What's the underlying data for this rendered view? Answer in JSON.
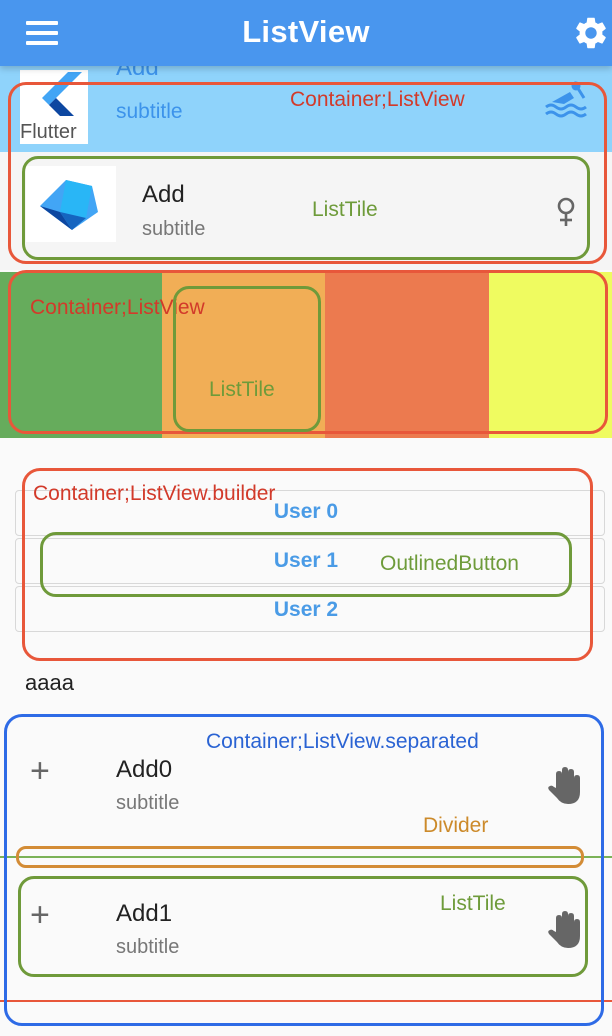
{
  "app_bar": {
    "title": "ListView",
    "background": "#4996EE"
  },
  "section1": {
    "cut_title": "Add",
    "top_subtitle": "subtitle",
    "flutter_logo_text": "Flutter",
    "tile": {
      "title": "Add",
      "subtitle": "subtitle"
    },
    "annotations": {
      "container": "Container;ListView",
      "tile": "ListTile"
    }
  },
  "section2": {
    "stripe_colors": [
      "#66AC5C",
      "#F1AE56",
      "#EC7A4F",
      "#EFFB60"
    ],
    "annotations": {
      "container": "Container;ListView",
      "tile": "ListTile"
    }
  },
  "section3": {
    "users": [
      "User 0",
      "User 1",
      "User 2"
    ],
    "annotations": {
      "container": "Container;ListView.builder",
      "button": "OutlinedButton"
    }
  },
  "static_text": "aaaa",
  "section4": {
    "items": [
      {
        "title": "Add0",
        "subtitle": "subtitle"
      },
      {
        "title": "Add1",
        "subtitle": "subtitle"
      }
    ],
    "annotations": {
      "container": "Container;ListView.separated",
      "divider": "Divider",
      "tile": "ListTile"
    }
  },
  "colors": {
    "annotation_red": "#D23A2A",
    "annotation_green": "#6E9B3A",
    "annotation_blue": "#2A63D3",
    "annotation_orange": "#CC8A2A"
  }
}
